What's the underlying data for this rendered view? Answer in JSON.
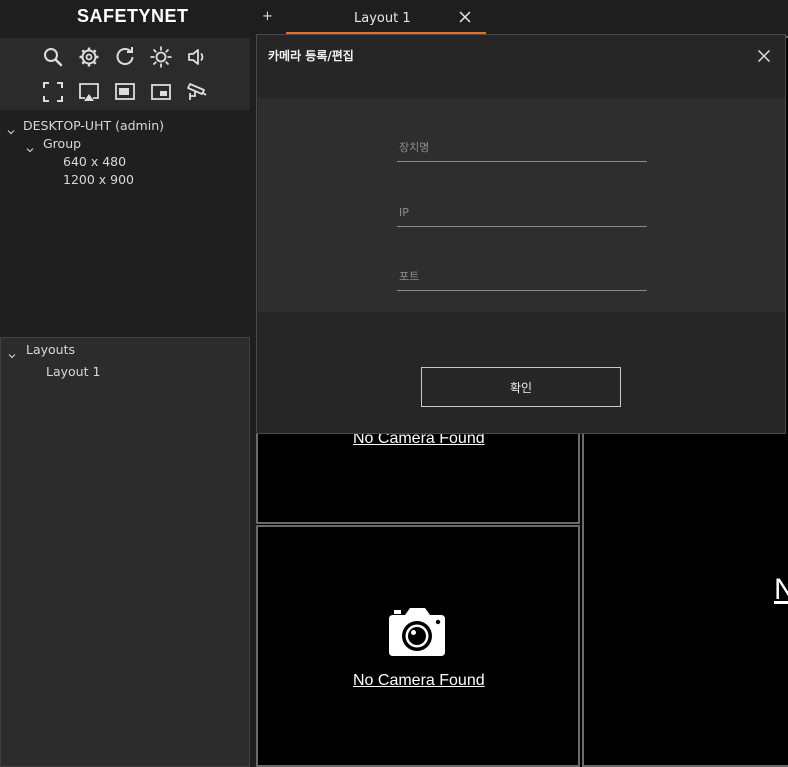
{
  "app": {
    "logo": "SAFETYNET"
  },
  "tabs": {
    "add_label": "+",
    "items": [
      {
        "label": "Layout 1"
      }
    ]
  },
  "toolbar": {
    "row1": [
      "search-icon",
      "settings-icon",
      "refresh-icon",
      "brightness-icon",
      "volume-icon"
    ],
    "row2": [
      "fullscreen-icon",
      "cast-icon",
      "window-icon",
      "picture-in-picture-icon",
      "cctv-icon"
    ]
  },
  "device_tree": {
    "root": "DESKTOP-UHT (admin)",
    "group": "Group",
    "items": [
      "640 x 480",
      "1200 x 900"
    ]
  },
  "layouts_panel": {
    "header": "Layouts",
    "items": [
      "Layout 1"
    ]
  },
  "cameras": {
    "no_camera_text": "No Camera Found",
    "partial_right_text": "N"
  },
  "modal": {
    "title": "카메라 등록/편집",
    "fields": {
      "device_name": {
        "placeholder": "장치명",
        "value": ""
      },
      "ip": {
        "placeholder": "IP",
        "value": ""
      },
      "port": {
        "placeholder": "포트",
        "value": ""
      }
    },
    "confirm_label": "확인"
  },
  "colors": {
    "accent": "#e0702a",
    "background": "#1f1f1f",
    "panel": "#2c2c2c",
    "video": "#000000"
  }
}
